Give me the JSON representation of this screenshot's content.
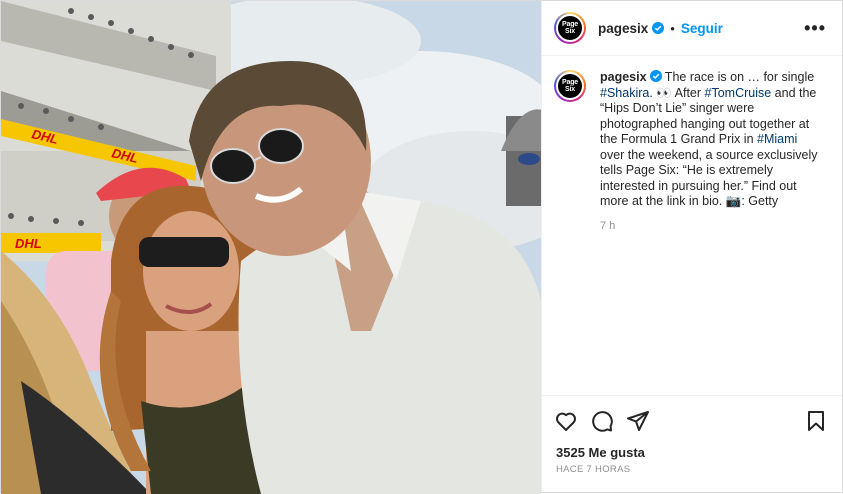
{
  "post": {
    "username": "pagesix",
    "follow_label": "Seguir",
    "more_label": "•••",
    "avatar_text_top": "Page",
    "avatar_text_bottom": "Six"
  },
  "caption": {
    "username": "pagesix",
    "t1": " The race is on … for single ",
    "tag1": "#Shakira",
    "t2": ". 👀 After ",
    "tag2": "#TomCruise",
    "t3": " and the “Hips Don’t Lie” singer were photographed hanging out together at the Formula 1 Grand Prix in ",
    "tag3": "#Miami",
    "t4": " over the weekend, a source exclusively tells Page Six: “He is extremely interested in pursuing her.” Find out more at the link in bio. 📷: Getty",
    "time": "7 h"
  },
  "engagement": {
    "likes": "3525 Me gusta",
    "ago": "HACE 7 HORAS"
  },
  "photo": {
    "banner_text": "DHL"
  },
  "colors": {
    "accent": "#0095f6",
    "verified": "#0095f6",
    "hashtag": "#00376b",
    "dhl_yellow": "#f6c700",
    "dhl_red": "#d40511"
  },
  "icons": [
    "verified-badge-icon",
    "heart-icon",
    "comment-icon",
    "share-icon",
    "bookmark-icon",
    "more-options-icon"
  ]
}
